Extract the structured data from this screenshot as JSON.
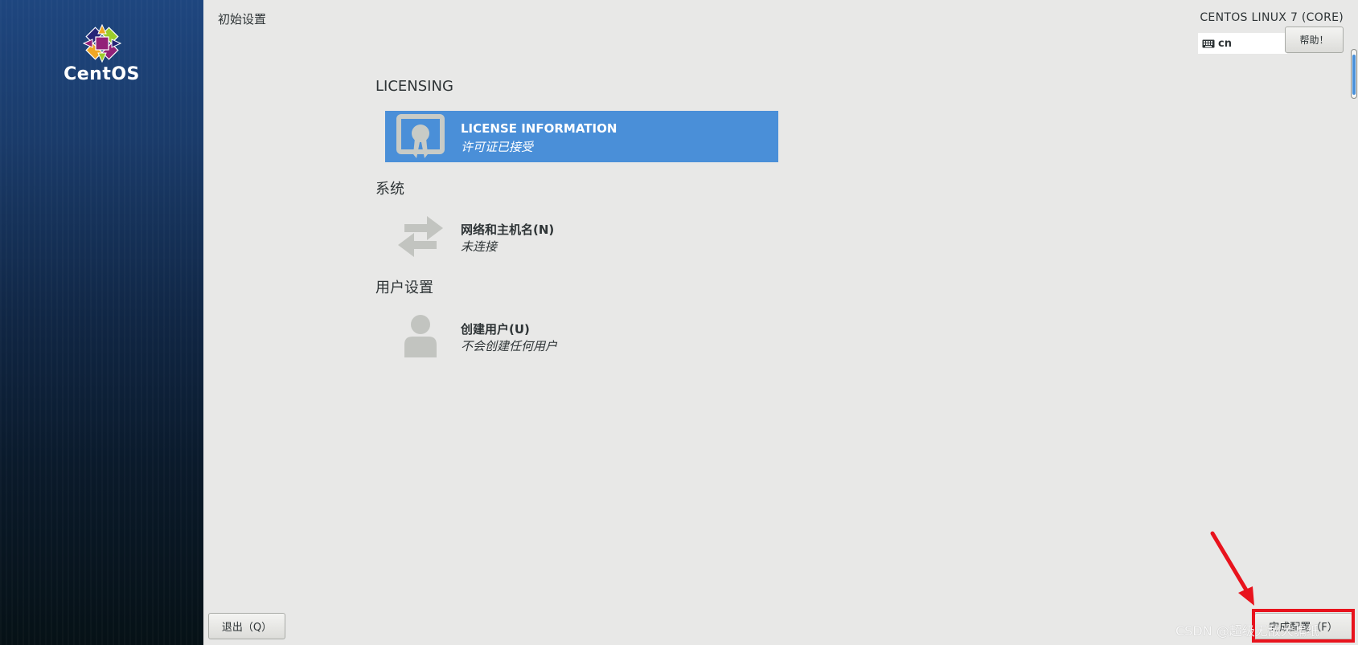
{
  "sidebar": {
    "logo_text": "CentOS"
  },
  "header": {
    "title": "初始设置",
    "product": "CENTOS LINUX 7 (CORE)",
    "keyboard_layout": "cn",
    "help_label": "帮助！"
  },
  "sections": [
    {
      "heading": "LICENSING",
      "spokes": [
        {
          "title": "LICENSE INFORMATION",
          "status": "许可证已接受",
          "icon": "license-certificate-icon",
          "selected": true
        }
      ]
    },
    {
      "heading": "系统",
      "spokes": [
        {
          "title": "网络和主机名(N)",
          "status": "未连接",
          "icon": "network-arrows-icon",
          "selected": false
        }
      ]
    },
    {
      "heading": "用户设置",
      "spokes": [
        {
          "title": "创建用户(U)",
          "status": "不会创建任何用户",
          "icon": "user-icon",
          "selected": false
        }
      ]
    }
  ],
  "footer": {
    "quit_label": "退出（Q）",
    "finish_label": "完成配置（F）"
  },
  "overlay": {
    "watermark": "CSDN @超级无敌大骗纸",
    "annotation_color": "#e8131d"
  },
  "colors": {
    "selected_spoke": "#4a8fd8",
    "background": "#e8e8e7",
    "text": "#2e3436"
  }
}
